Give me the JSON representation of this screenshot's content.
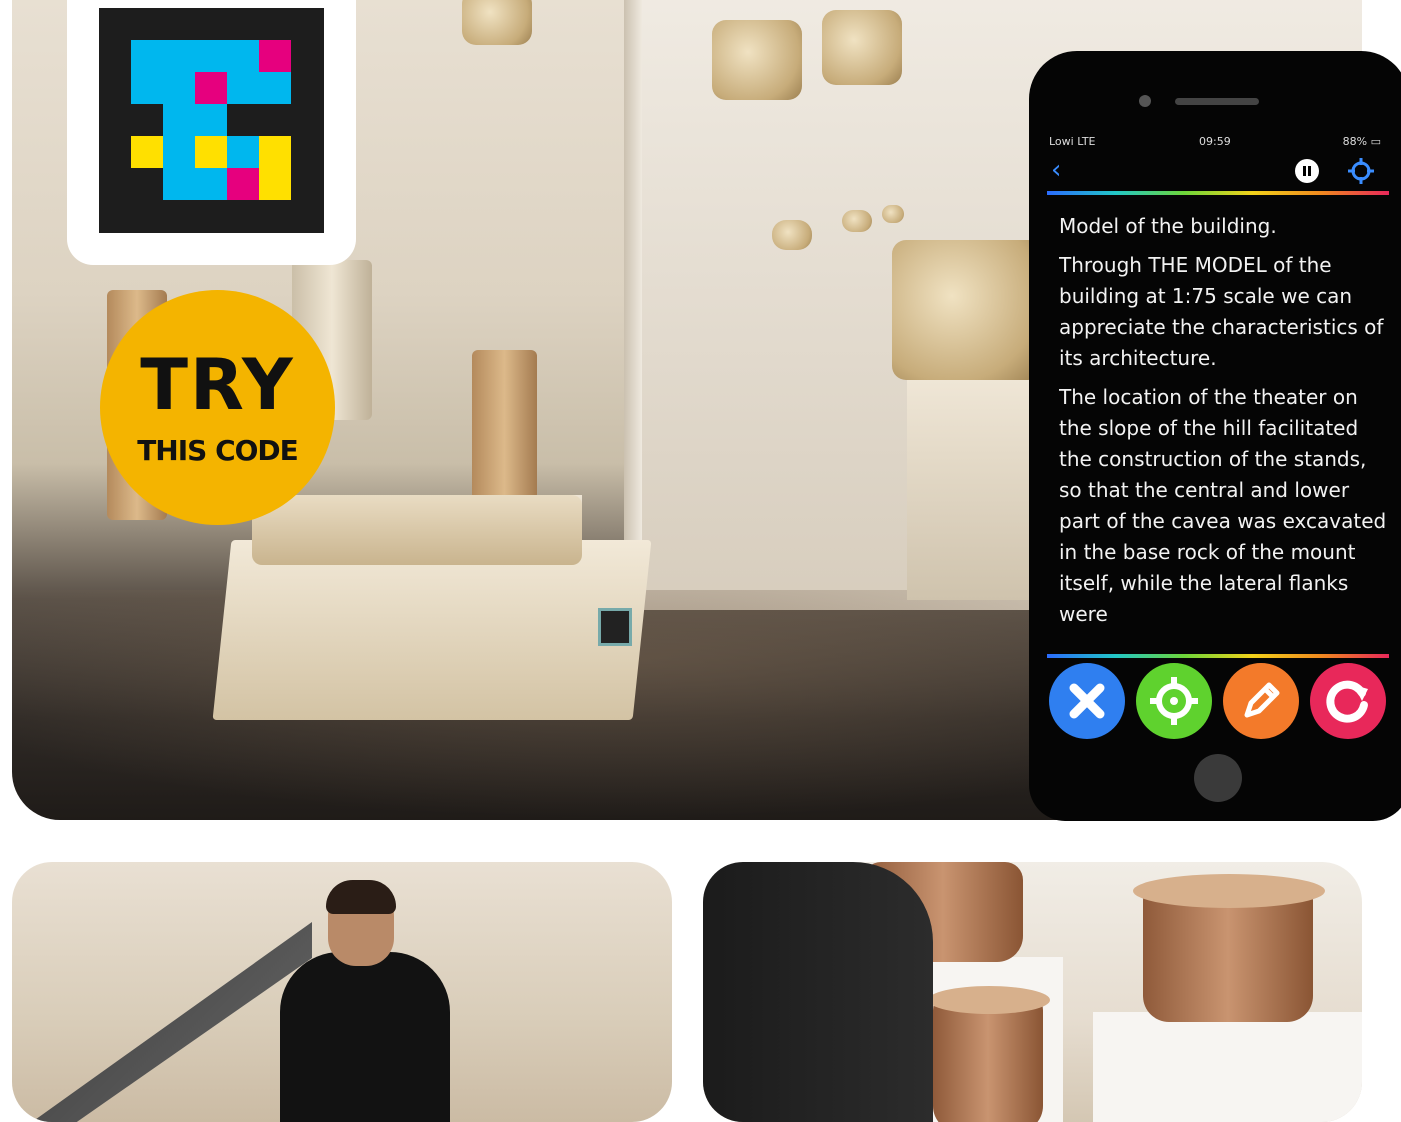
{
  "badge": {
    "line1": "TRY",
    "line2": "THIS CODE"
  },
  "phone": {
    "status": {
      "carrier": "Lowi  LTE",
      "time": "09:59",
      "battery": "88%"
    },
    "nav": {
      "back_icon": "chevron-left-icon",
      "pause_icon": "pause-icon",
      "locate_icon": "crosshair-icon"
    },
    "article": {
      "title": "Model of the building.",
      "p1": "Through THE MODEL of the building at 1:75 scale we can appreciate the characteristics of its architecture.",
      "p2": "The location of the theater on the slope of the hill facilitated the construction of the stands, so that the central and lower part of the cavea was excavated in the base rock of the mount itself, while the lateral flanks were"
    },
    "actions": [
      {
        "name": "close",
        "icon": "close-icon",
        "color": "#2f7ff0"
      },
      {
        "name": "locate",
        "icon": "crosshair-icon",
        "color": "#5fd22e"
      },
      {
        "name": "edit",
        "icon": "pencil-icon",
        "color": "#f37a2a"
      },
      {
        "name": "refresh",
        "icon": "refresh-icon",
        "color": "#e8285a"
      }
    ]
  },
  "colors": {
    "badge": "#f4b400",
    "code_blue": "#00b7ee",
    "code_pink": "#e6007e",
    "code_yellow": "#ffe000"
  }
}
